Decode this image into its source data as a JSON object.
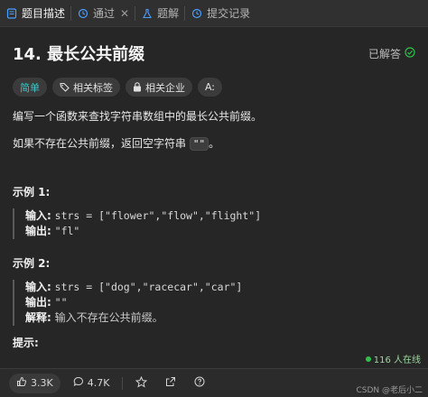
{
  "tabs": [
    {
      "label": "题目描述",
      "icon": "description-icon",
      "active": true
    },
    {
      "label": "通过",
      "icon": "history-icon",
      "active": false
    },
    {
      "label": "题解",
      "icon": "flask-icon",
      "active": false
    },
    {
      "label": "提交记录",
      "icon": "history-icon",
      "active": false
    }
  ],
  "problem": {
    "title": "14. 最长公共前缀",
    "solved_label": "已解答",
    "tags": {
      "difficulty": "简单",
      "related_tags": "相关标签",
      "related_companies": "相关企业",
      "font_toggle": "Aː"
    },
    "description_1": "编写一个函数来查找字符串数组中的最长公共前缀。",
    "description_2_before": "如果不存在公共前缀，返回空字符串 ",
    "description_2_code": "\"\"",
    "description_2_after": "。"
  },
  "examples": [
    {
      "title": "示例 1:",
      "input_label": "输入:",
      "input_value": "strs = [\"flower\",\"flow\",\"flight\"]",
      "output_label": "输出:",
      "output_value": "\"fl\""
    },
    {
      "title": "示例 2:",
      "input_label": "输入:",
      "input_value": "strs = [\"dog\",\"racecar\",\"car\"]",
      "output_label": "输出:",
      "output_value": "\"\"",
      "explain_label": "解释:",
      "explain_value": "输入不存在公共前缀。"
    }
  ],
  "hint_title": "提示:",
  "online": "116 人在线",
  "bottom": {
    "likes": "3.3K",
    "comments": "4.7K"
  },
  "watermark": "CSDN @老后小二",
  "colors": {
    "easy": "#3ec5c9",
    "solved_check": "#2fbf4a",
    "online_dot": "#2fbf4a"
  }
}
